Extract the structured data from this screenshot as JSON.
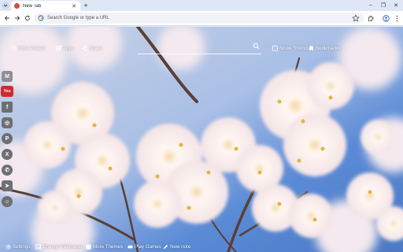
{
  "browser": {
    "tab_title": "New Tab",
    "omnibox_placeholder": "Search Google or type a URL"
  },
  "top_nav": {
    "most_visited": "Most Visited",
    "apps": "Apps",
    "share": "Share",
    "show_shortcuts": "Show Shortcuts",
    "bookmarks": "Bookmarks"
  },
  "sidebar": {
    "items": [
      {
        "icon": "gmail-icon",
        "glyph": "M"
      },
      {
        "icon": "youtube-icon",
        "glyph": "You"
      },
      {
        "icon": "facebook-icon",
        "glyph": "f"
      },
      {
        "icon": "instagram-icon",
        "glyph": "◎"
      },
      {
        "icon": "pinterest-icon",
        "glyph": "P"
      },
      {
        "icon": "x-icon",
        "glyph": "X"
      },
      {
        "icon": "whatsapp-icon",
        "glyph": "✆"
      },
      {
        "icon": "telegram-icon",
        "glyph": "➤"
      },
      {
        "icon": "reddit-icon",
        "glyph": "☺"
      }
    ]
  },
  "bottom_bar": {
    "settings": "Settings",
    "change_wallpaper": "Change Wallpaper",
    "more_themes": "More Themes",
    "play_games": "Play Games",
    "new_note": "New note"
  },
  "colors": {
    "sky": "#5b8bd6",
    "blossom": "#fbf4f4",
    "blossom_center": "#f2c85a",
    "branch": "#5a3f35"
  }
}
